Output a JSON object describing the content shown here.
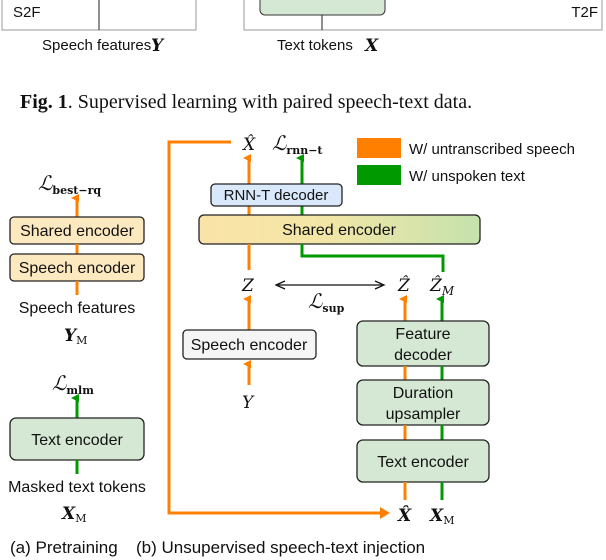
{
  "top_figure": {
    "s2f_label": "S2F",
    "t2f_label": "T2F",
    "speech_features_label": "Speech features",
    "speech_features_symbol": "Y",
    "text_tokens_label": "Text tokens",
    "text_tokens_symbol": "X"
  },
  "fig1_caption": {
    "prefix": "Fig. 1",
    "text": ". Supervised learning with paired speech-text data."
  },
  "legend": {
    "items": [
      {
        "label": "W/ untranscribed speech",
        "color": "#ff8000"
      },
      {
        "label": "W/ unspoken text",
        "color": "#009900"
      }
    ]
  },
  "colors": {
    "orange": "#ff8000",
    "green": "#009900",
    "yellow_box": "#fde9bf",
    "green_box": "#d5e8d4",
    "blue_box": "#dae8fc",
    "gray_box": "#f5f5f5"
  },
  "pretraining": {
    "loss_best_rq": {
      "main": "ℒ",
      "sub": "best−rq"
    },
    "shared_encoder": "Shared encoder",
    "speech_encoder": "Speech encoder",
    "speech_features": "Speech features",
    "speech_symbol": {
      "main": "Y",
      "sub": "M"
    },
    "loss_mlm": {
      "main": "ℒ",
      "sub": "mlm"
    },
    "text_encoder": "Text encoder",
    "masked_text_tokens": "Masked text tokens",
    "text_symbol": {
      "main": "X",
      "sub": "M"
    },
    "caption": "(a) Pretraining"
  },
  "injection": {
    "x_hat_top": "X̂",
    "loss_rnnt": {
      "main": "ℒ",
      "sub": "rnn−t"
    },
    "rnnt_decoder": "RNN-T decoder",
    "shared_encoder": "Shared encoder",
    "z": "Z",
    "loss_sup": {
      "main": "ℒ",
      "sub": "sup"
    },
    "z_hat": "Ẑ",
    "z_hat_m": {
      "main": "Ẑ",
      "sub": "M"
    },
    "speech_encoder": "Speech encoder",
    "y": "Y",
    "feature_decoder": [
      "Feature",
      "decoder"
    ],
    "duration_upsampler": [
      "Duration",
      "upsampler"
    ],
    "text_encoder": "Text encoder",
    "x_hat_bottom": "X̂",
    "x_m": {
      "main": "X",
      "sub": "M"
    },
    "caption": "(b) Unsupervised speech-text injection"
  }
}
